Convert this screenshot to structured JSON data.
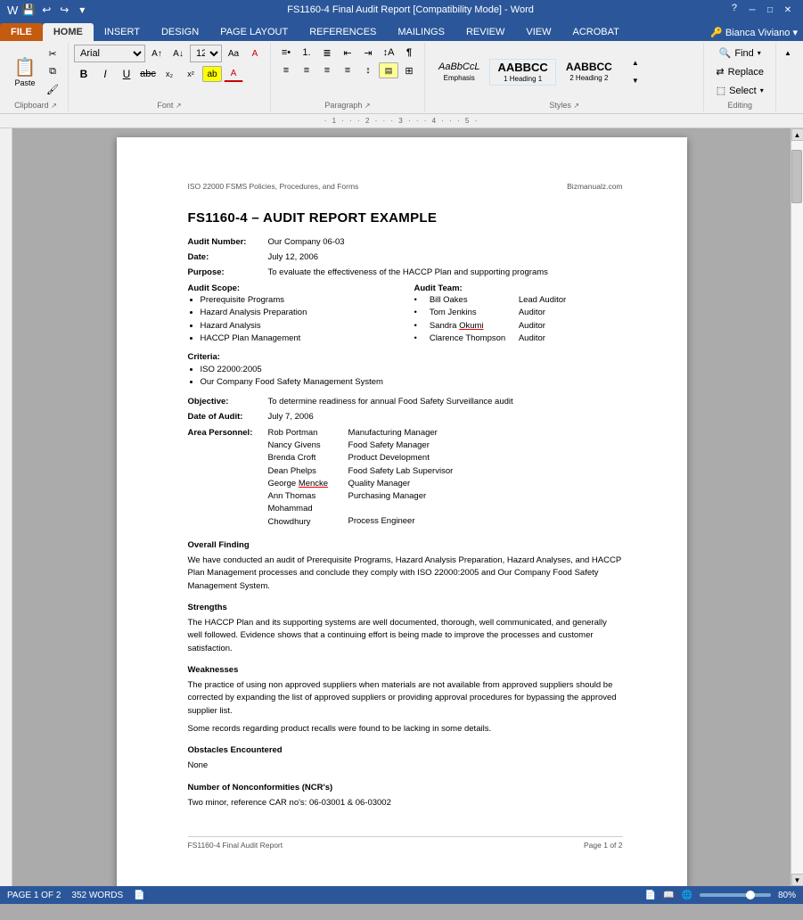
{
  "titlebar": {
    "title": "FS1160-4 Final Audit Report [Compatibility Mode] - Word",
    "minimize": "─",
    "restore": "□",
    "close": "✕",
    "help": "?"
  },
  "qat": {
    "save": "💾",
    "undo": "↩",
    "redo": "↪",
    "more": "▾"
  },
  "ribbon": {
    "tabs": [
      "FILE",
      "HOME",
      "INSERT",
      "DESIGN",
      "PAGE LAYOUT",
      "REFERENCES",
      "MAILINGS",
      "REVIEW",
      "VIEW",
      "ACROBAT"
    ],
    "active_tab": "HOME",
    "font_name": "Arial",
    "font_size": "12",
    "bold": "B",
    "italic": "I",
    "underline": "U",
    "strikethrough": "abc",
    "subscript": "x₂",
    "superscript": "x²",
    "groups": {
      "clipboard": "Clipboard",
      "font": "Font",
      "paragraph": "Paragraph",
      "styles": "Styles",
      "editing": "Editing"
    },
    "styles": [
      {
        "name": "Emphasis",
        "sample": "AaBbCcL",
        "style": "italic"
      },
      {
        "name": "1 Heading 1",
        "sample": "AABBCC",
        "style": "bold,large"
      },
      {
        "name": "2 Heading 2",
        "sample": "AABBCC",
        "style": "bold"
      }
    ],
    "editing": {
      "find": "Find",
      "replace": "Replace",
      "select": "Select"
    }
  },
  "document": {
    "header_left": "ISO 22000 FSMS Policies, Procedures, and Forms",
    "header_right": "Bizmanualz.com",
    "title": "FS1160-4 – AUDIT REPORT EXAMPLE",
    "audit_number_label": "Audit Number:",
    "audit_number_value": "Our Company 06-03",
    "date_label": "Date:",
    "date_value": "July 12, 2006",
    "purpose_label": "Purpose:",
    "purpose_value": "To evaluate the effectiveness of the HACCP Plan and supporting programs",
    "audit_scope_label": "Audit Scope:",
    "audit_scope_items": [
      "Prerequisite Programs",
      "Hazard Analysis Preparation",
      "Hazard Analysis",
      "HACCP Plan Management"
    ],
    "audit_team_label": "Audit Team:",
    "audit_team": [
      {
        "name": "Bill Oakes",
        "role": "Lead Auditor"
      },
      {
        "name": "Tom Jenkins",
        "role": "Auditor"
      },
      {
        "name": "Sandra Okumi",
        "role": "Auditor"
      },
      {
        "name": "Clarence Thompson",
        "role": "Auditor"
      }
    ],
    "criteria_label": "Criteria:",
    "criteria_items": [
      "ISO 22000:2005",
      "Our Company Food Safety Management System"
    ],
    "objective_label": "Objective:",
    "objective_value": "To determine readiness for annual Food Safety Surveillance audit",
    "date_of_audit_label": "Date of Audit:",
    "date_of_audit_value": "July 7, 2006",
    "area_personnel_label": "Area Personnel:",
    "personnel": [
      {
        "name": "Rob Portman",
        "role": "Manufacturing Manager"
      },
      {
        "name": "Nancy Givens",
        "role": "Food Safety Manager"
      },
      {
        "name": "Brenda Croft",
        "role": "Product Development"
      },
      {
        "name": "Dean Phelps",
        "role": "Food Safety Lab Supervisor"
      },
      {
        "name": "George Mencke",
        "role": "Quality Manager"
      },
      {
        "name": "Ann Thomas",
        "role": "Purchasing Manager"
      },
      {
        "name": "Mohammad Chowdhury",
        "role": "Process Engineer"
      }
    ],
    "overall_finding_heading": "Overall Finding",
    "overall_finding_text": "We have conducted an audit of Prerequisite Programs, Hazard Analysis Preparation, Hazard Analyses, and HACCP Plan Management processes and conclude they comply with ISO 22000:2005 and Our Company Food Safety Management System.",
    "strengths_heading": "Strengths",
    "strengths_text": "The HACCP Plan and its supporting systems are well documented, thorough, well communicated, and generally well followed. Evidence shows that a continuing effort is being made to improve the processes and customer satisfaction.",
    "weaknesses_heading": "Weaknesses",
    "weaknesses_text1": "The practice of using non approved suppliers when materials are not available from approved suppliers should be corrected by expanding the list of approved suppliers or providing approval procedures for bypassing the approved supplier list.",
    "weaknesses_text2": "Some records regarding product recalls were found to be lacking in some details.",
    "obstacles_heading": "Obstacles Encountered",
    "obstacles_text": "None",
    "ncr_heading": "Number of Nonconformities (NCR's)",
    "ncr_text": "Two minor, reference CAR no's: 06-03001 & 06-03002",
    "footer_left": "FS1160-4 Final Audit Report",
    "footer_right": "Page 1 of 2"
  },
  "statusbar": {
    "page": "PAGE 1 OF 2",
    "words": "352 WORDS",
    "zoom": "80%"
  }
}
